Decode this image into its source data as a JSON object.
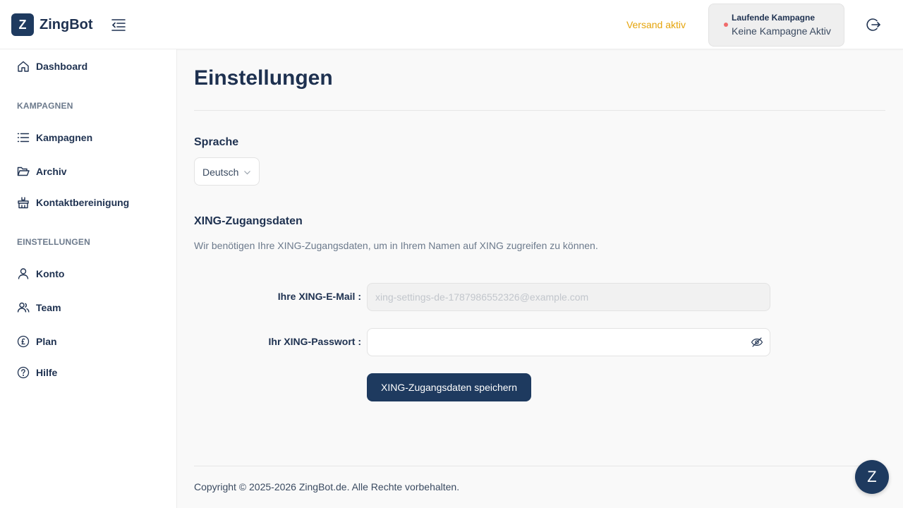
{
  "app": {
    "logo_letter": "Z",
    "name": "ZingBot"
  },
  "header": {
    "shipping_status": "Versand aktiv",
    "campaign_title": "Laufende Kampagne",
    "campaign_status": "Keine Kampagne Aktiv",
    "status_dot_color": "#f06b6b",
    "shipping_color": "#e5a40b"
  },
  "sidebar": {
    "dashboard": "Dashboard",
    "section_campaigns": "KAMPAGNEN",
    "campaigns": "Kampagnen",
    "archive": "Archiv",
    "contact_cleanup": "Kontaktbereinigung",
    "section_settings": "EINSTELLUNGEN",
    "account": "Konto",
    "team": "Team",
    "plan": "Plan",
    "help": "Hilfe"
  },
  "main": {
    "title": "Einstellungen",
    "language_heading": "Sprache",
    "language_value": "Deutsch",
    "xing_heading": "XING-Zugangsdaten",
    "xing_description": "Wir benötigen Ihre XING-Zugangsdaten, um in Ihrem Namen auf XING zugreifen zu können.",
    "email_label": "Ihre XING-E-Mail :",
    "email_placeholder": "xing-settings-de-1787986552326@example.com",
    "password_label": "Ihr XING-Passwort :",
    "password_value": "",
    "save_button": "XING-Zugangsdaten speichern"
  },
  "footer": {
    "copyright": "Copyright © 2025-2026 ZingBot.de. Alle Rechte vorbehalten."
  },
  "chat": {
    "letter": "Z"
  },
  "colors": {
    "brand": "#1e3a5f",
    "text": "#1e3150"
  }
}
